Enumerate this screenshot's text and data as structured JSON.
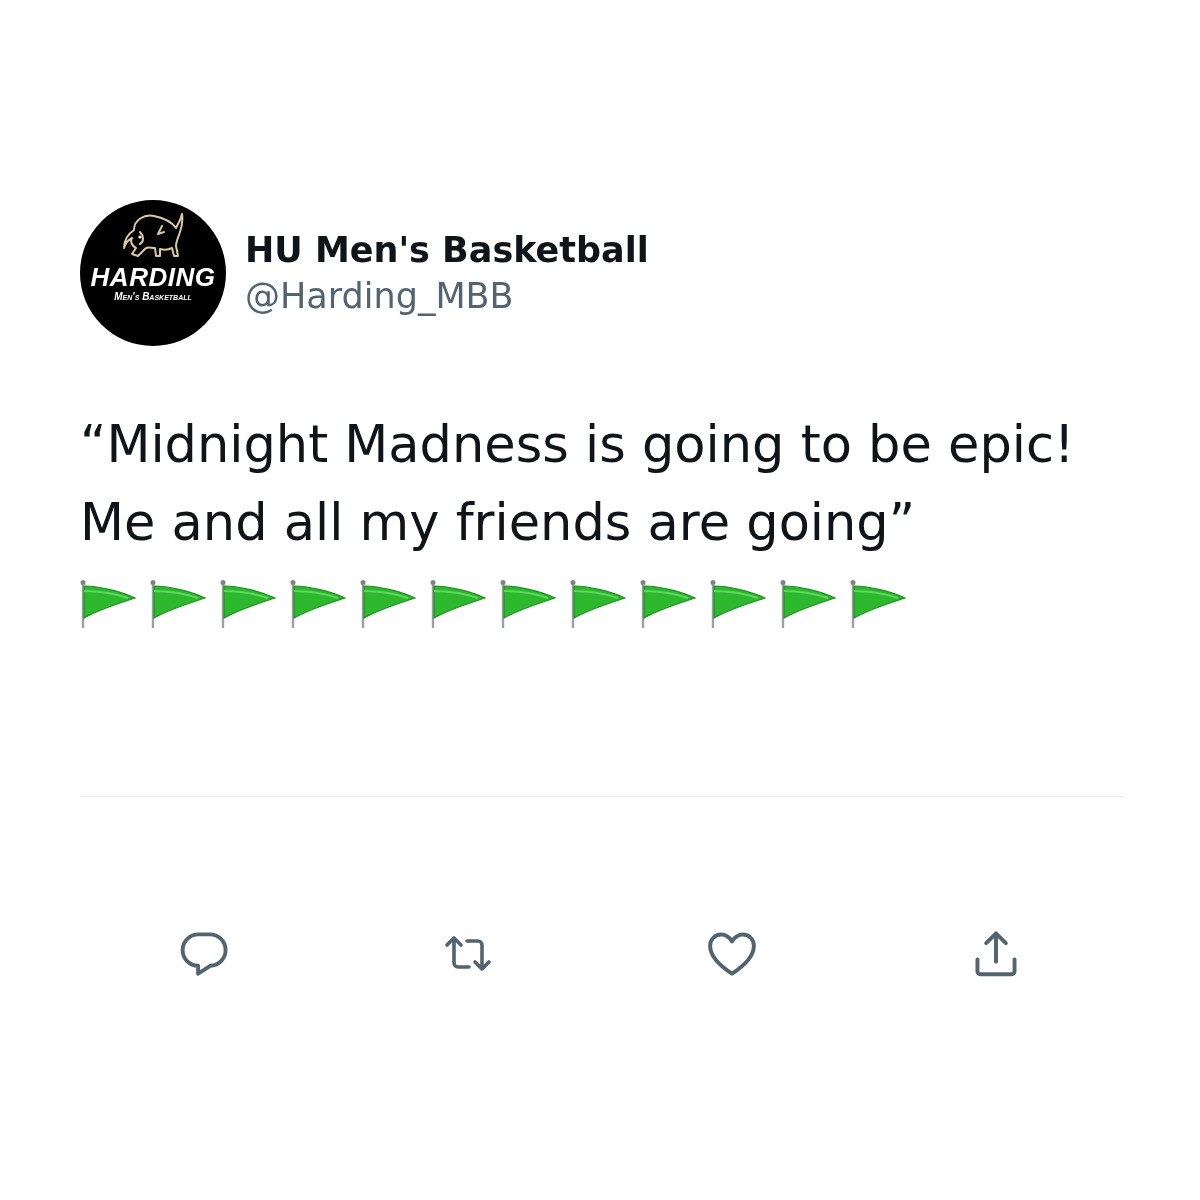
{
  "profile": {
    "logo": {
      "wordmark": "HARDING",
      "subtitle": "Men's Basketball"
    },
    "name": "HU Men's Basketball",
    "handle": "@Harding_MBB"
  },
  "tweet": {
    "text": "“Midnight Madness is going to be epic!\nMe and all my friends are going”",
    "emoji": [
      {
        "kind": "flag"
      },
      {
        "kind": "flag"
      },
      {
        "kind": "flag"
      },
      {
        "kind": "flag"
      },
      {
        "kind": "flag"
      },
      {
        "kind": "flag"
      },
      {
        "kind": "flag"
      },
      {
        "kind": "flag"
      },
      {
        "kind": "flag"
      },
      {
        "kind": "flag"
      },
      {
        "kind": "flag"
      },
      {
        "kind": "flag"
      }
    ]
  },
  "actions": [
    {
      "kind": "reply"
    },
    {
      "kind": "retweet"
    },
    {
      "kind": "like"
    },
    {
      "kind": "share"
    }
  ]
}
